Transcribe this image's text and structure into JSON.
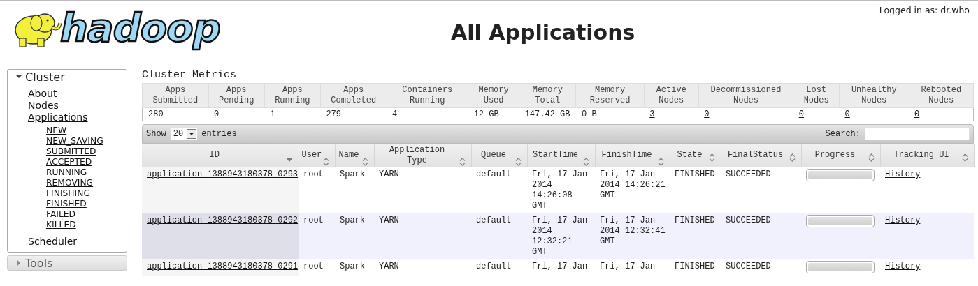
{
  "header": {
    "logo_text": "hadoop",
    "title": "All Applications",
    "logged_in": "Logged in as: dr.who"
  },
  "sidebar": [
    {
      "label": "Cluster",
      "expanded": true,
      "links": [
        {
          "label": "About"
        },
        {
          "label": "Nodes"
        },
        {
          "label": "Applications",
          "children": [
            {
              "label": "NEW"
            },
            {
              "label": "NEW_SAVING"
            },
            {
              "label": "SUBMITTED"
            },
            {
              "label": "ACCEPTED"
            },
            {
              "label": "RUNNING"
            },
            {
              "label": "REMOVING"
            },
            {
              "label": "FINISHING"
            },
            {
              "label": "FINISHED"
            },
            {
              "label": "FAILED"
            },
            {
              "label": "KILLED"
            }
          ]
        },
        {
          "label": "Scheduler"
        }
      ]
    },
    {
      "label": "Tools",
      "expanded": false
    }
  ],
  "cluster_metrics": {
    "title": "Cluster Metrics",
    "columns": [
      {
        "label": "Apps Submitted",
        "value": "280",
        "link": false
      },
      {
        "label": "Apps Pending",
        "value": "0",
        "link": false
      },
      {
        "label": "Apps Running",
        "value": "1",
        "link": false
      },
      {
        "label": "Apps Completed",
        "value": "279",
        "link": false
      },
      {
        "label": "Containers Running",
        "value": "4",
        "link": false
      },
      {
        "label": "Memory Used",
        "value": "12 GB",
        "link": false
      },
      {
        "label": "Memory Total",
        "value": "147.42 GB",
        "link": false
      },
      {
        "label": "Memory Reserved",
        "value": "0 B",
        "link": false
      },
      {
        "label": "Active Nodes",
        "value": "3",
        "link": true
      },
      {
        "label": "Decommissioned Nodes",
        "value": "0",
        "link": true
      },
      {
        "label": "Lost Nodes",
        "value": "0",
        "link": true
      },
      {
        "label": "Unhealthy Nodes",
        "value": "0",
        "link": true
      },
      {
        "label": "Rebooted Nodes",
        "value": "0",
        "link": true
      }
    ]
  },
  "applications": {
    "show_label": "Show",
    "page_size": "20",
    "entries_label": "entries",
    "search_label": "Search:",
    "columns": [
      {
        "label": "ID",
        "sorted": true
      },
      {
        "label": "User",
        "sorted": false
      },
      {
        "label": "Name",
        "sorted": false
      },
      {
        "label": "Application Type",
        "sorted": false
      },
      {
        "label": "Queue",
        "sorted": false
      },
      {
        "label": "StartTime",
        "sorted": false
      },
      {
        "label": "FinishTime",
        "sorted": false
      },
      {
        "label": "State",
        "sorted": false
      },
      {
        "label": "FinalStatus",
        "sorted": false
      },
      {
        "label": "Progress",
        "sorted": false
      },
      {
        "label": "Tracking UI",
        "sorted": false
      }
    ],
    "rows": [
      {
        "id": "application_1388943180378_0293",
        "user": "root",
        "name": "Spark",
        "type": "YARN",
        "queue": "default",
        "start": "Fri, 17 Jan 2014 14:26:08 GMT",
        "finish": "Fri, 17 Jan 2014 14:26:21 GMT",
        "state": "FINISHED",
        "final_status": "SUCCEEDED",
        "level": 1,
        "tracking": "History"
      },
      {
        "id": "application_1388943180378_0292",
        "user": "root",
        "name": "Spark",
        "type": "YARN",
        "queue": "default",
        "start": "Fri, 17 Jan 2014 12:32:21 GMT",
        "finish": "Fri, 17 Jan 2014 12:32:41 GMT",
        "state": "FINISHED",
        "final_status": "SUCCEEDED",
        "level": 1,
        "tracking": "History"
      },
      {
        "id": "application_1388943180378_0291",
        "user": "root",
        "name": "Spark",
        "type": "YARN",
        "queue": "default",
        "start": "Fri, 17 Jan",
        "finish": "Fri, 17 Jan",
        "state": "FINISHED",
        "final_status": "SUCCEEDED",
        "level": 1,
        "tracking": "History"
      }
    ]
  }
}
